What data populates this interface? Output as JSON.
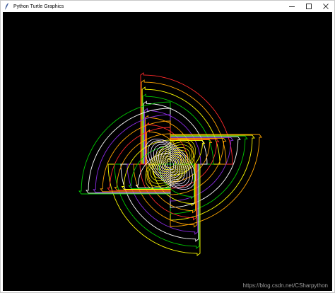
{
  "window": {
    "title": "Python Turtle Graphics",
    "minimize_icon": "minimize-icon",
    "maximize_icon": "maximize-icon",
    "close_icon": "close-icon",
    "app_icon": "feather-icon"
  },
  "canvas": {
    "background": "#000000",
    "watermark": "https://blog.csdn.net/CSharpython"
  },
  "drawing": {
    "colors": [
      "#ff2a2a",
      "#ffa500",
      "#ffff00",
      "#00cc00",
      "#ffffff",
      "#8a2be2",
      "#ffa500"
    ]
  }
}
